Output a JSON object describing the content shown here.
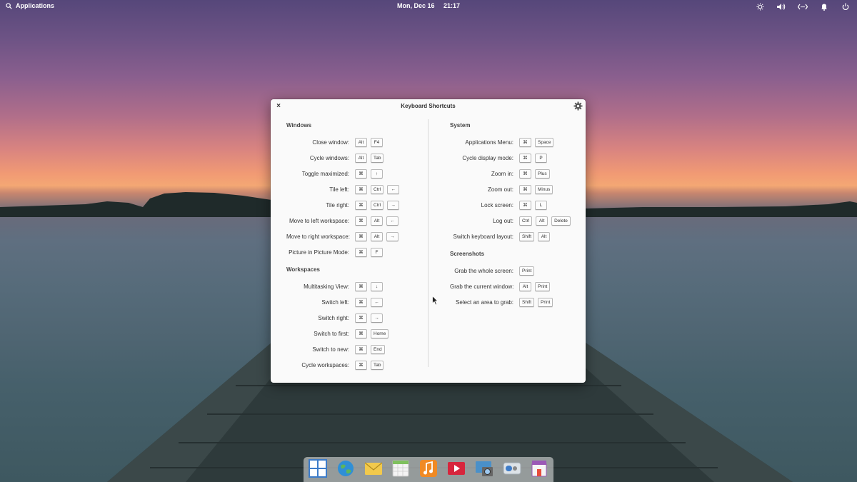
{
  "top_panel": {
    "applications_label": "Applications",
    "date": "Mon, Dec 16",
    "time": "21:17",
    "indicators": [
      "brightness-icon",
      "volume-icon",
      "network-icon",
      "notifications-icon",
      "power-icon"
    ]
  },
  "dialog": {
    "title": "Keyboard Shortcuts",
    "close_symbol": "×",
    "left_sections": [
      {
        "title": "Windows",
        "rows": [
          {
            "label": "Close window:",
            "keys": [
              "Alt",
              "F4"
            ]
          },
          {
            "label": "Cycle windows:",
            "keys": [
              "Alt",
              "Tab"
            ]
          },
          {
            "label": "Toggle maximized:",
            "keys": [
              "⌘",
              "↑"
            ]
          },
          {
            "label": "Tile left:",
            "keys": [
              "⌘",
              "Ctrl",
              "←"
            ]
          },
          {
            "label": "Tile right:",
            "keys": [
              "⌘",
              "Ctrl",
              "→"
            ]
          },
          {
            "label": "Move to left workspace:",
            "keys": [
              "⌘",
              "Alt",
              "←"
            ]
          },
          {
            "label": "Move to right workspace:",
            "keys": [
              "⌘",
              "Alt",
              "→"
            ]
          },
          {
            "label": "Picture in Picture Mode:",
            "keys": [
              "⌘",
              "F"
            ]
          }
        ]
      },
      {
        "title": "Workspaces",
        "rows": [
          {
            "label": "Multitasking View:",
            "keys": [
              "⌘",
              "↓"
            ]
          },
          {
            "label": "Switch left:",
            "keys": [
              "⌘",
              "←"
            ]
          },
          {
            "label": "Switch right:",
            "keys": [
              "⌘",
              "→"
            ]
          },
          {
            "label": "Switch to first:",
            "keys": [
              "⌘",
              "Home"
            ]
          },
          {
            "label": "Switch to new:",
            "keys": [
              "⌘",
              "End"
            ]
          },
          {
            "label": "Cycle workspaces:",
            "keys": [
              "⌘",
              "Tab"
            ]
          }
        ]
      }
    ],
    "right_sections": [
      {
        "title": "System",
        "rows": [
          {
            "label": "Applications Menu:",
            "keys": [
              "⌘",
              "Space"
            ]
          },
          {
            "label": "Cycle display mode:",
            "keys": [
              "⌘",
              "P"
            ]
          },
          {
            "label": "Zoom in:",
            "keys": [
              "⌘",
              "Plus"
            ]
          },
          {
            "label": "Zoom out:",
            "keys": [
              "⌘",
              "Minus"
            ]
          },
          {
            "label": "Lock screen:",
            "keys": [
              "⌘",
              "L"
            ]
          },
          {
            "label": "Log out:",
            "keys": [
              "Ctrl",
              "Alt",
              "Delete"
            ]
          },
          {
            "label": "Switch keyboard layout:",
            "keys": [
              "Shift",
              "Alt"
            ]
          }
        ]
      },
      {
        "title": "Screenshots",
        "rows": [
          {
            "label": "Grab the whole screen:",
            "keys": [
              "Print"
            ]
          },
          {
            "label": "Grab the current window:",
            "keys": [
              "Alt",
              "Print"
            ]
          },
          {
            "label": "Select an area to grab:",
            "keys": [
              "Shift",
              "Print"
            ]
          }
        ]
      }
    ]
  },
  "dock": {
    "items": [
      {
        "name": "multitasking-view-icon",
        "color": "#3d7cc9"
      },
      {
        "name": "web-browser-icon",
        "color": "#2f8fd6"
      },
      {
        "name": "mail-icon",
        "color": "#f2c94c"
      },
      {
        "name": "calendar-icon",
        "color": "#7fc15e"
      },
      {
        "name": "music-icon",
        "color": "#f08a24"
      },
      {
        "name": "videos-icon",
        "color": "#d7263d"
      },
      {
        "name": "photos-icon",
        "color": "#4a90c9"
      },
      {
        "name": "system-settings-icon",
        "color": "#a0a8b0"
      },
      {
        "name": "appcenter-icon",
        "color": "#9b59b6"
      }
    ]
  }
}
